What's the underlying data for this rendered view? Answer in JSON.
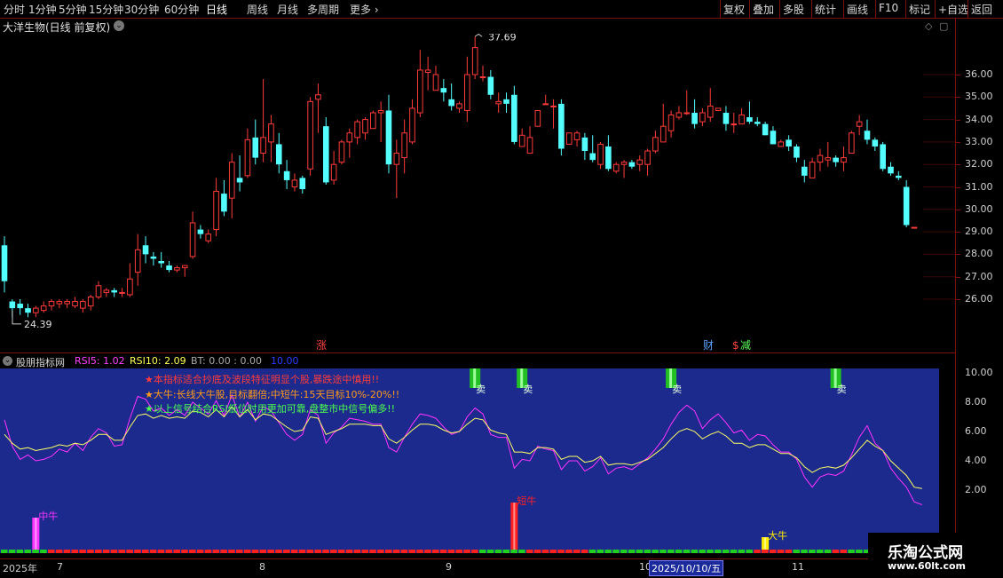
{
  "toolbar": {
    "periods": [
      "分时",
      "1分钟",
      "5分钟",
      "15分钟",
      "30分钟",
      "60分钟",
      "日线",
      "周线",
      "月线",
      "多周期"
    ],
    "active": "日线",
    "more": "更多",
    "right": [
      "复权",
      "叠加",
      "多股",
      "统计",
      "画线",
      "F10",
      "标记",
      "+自选",
      "返回"
    ]
  },
  "stock": {
    "title": "大洋生物(日线 前复权)"
  },
  "main": {
    "high_label": "37.69",
    "low_label": "24.39",
    "yticks": [
      "36.00",
      "35.00",
      "34.00",
      "33.00",
      "32.00",
      "31.00",
      "30.00",
      "29.00",
      "28.00",
      "27.00",
      "26.00"
    ],
    "markers": [
      "涨",
      "财",
      "$",
      "减"
    ]
  },
  "indicator": {
    "name": "股朋指标网",
    "rsi5": "RSI5: 1.02",
    "rsi10": "RSI10: 2.09",
    "bt": "BT: 0.00 : 0.00",
    "extra": "10.00",
    "yticks": [
      "10.00",
      "8.00",
      "6.00",
      "4.00",
      "2.00"
    ],
    "notes": [
      "★本指标适合抄底及波段特征明显个股,暴跌途中慎用!!",
      "★大牛:长线大牛股,目标翻倍;中短牛:15天目标10%-20%!!",
      "★以上信号结合RSI低位时用更加可靠,盘整市中信号偏多!!"
    ],
    "sell_label": "卖",
    "signal_labels": [
      "中牛",
      "短牛",
      "大牛"
    ]
  },
  "dates": {
    "year": "2025年",
    "months": [
      "7",
      "8",
      "9",
      "10",
      "11"
    ],
    "cursor": "2025/10/10/五"
  },
  "watermark": {
    "line1": "乐淘公式网",
    "line2": "www.60lt.com"
  },
  "chart_data": {
    "type": "candlestick",
    "price_range": [
      25.2,
      37.9
    ],
    "up_color": "#ff3b3b",
    "down_color": "#54ffff",
    "bars": [
      [
        28.4,
        26.8,
        28.8,
        26.3
      ],
      [
        25.9,
        25.6,
        26.0,
        25.2
      ],
      [
        25.8,
        25.6,
        26.0,
        25.3
      ],
      [
        25.6,
        25.4,
        25.8,
        25.2
      ],
      [
        25.4,
        25.6,
        25.7,
        25.2
      ],
      [
        25.5,
        25.7,
        25.9,
        25.4
      ],
      [
        25.7,
        25.9,
        26.0,
        25.5
      ],
      [
        25.8,
        25.9,
        26.0,
        25.6
      ],
      [
        25.8,
        25.9,
        26.0,
        25.6
      ],
      [
        25.7,
        25.9,
        26.1,
        25.6
      ],
      [
        25.6,
        25.9,
        26.0,
        25.4
      ],
      [
        25.7,
        26.1,
        26.2,
        25.5
      ],
      [
        26.1,
        26.6,
        26.8,
        26.0
      ],
      [
        26.3,
        26.4,
        26.5,
        26.1
      ],
      [
        26.4,
        26.3,
        26.5,
        26.1
      ],
      [
        26.3,
        26.3,
        26.5,
        26.1
      ],
      [
        26.2,
        26.9,
        27.6,
        26.1
      ],
      [
        27.2,
        28.2,
        28.9,
        26.6
      ],
      [
        28.4,
        28.0,
        28.8,
        27.6
      ],
      [
        27.9,
        27.8,
        28.1,
        27.5
      ],
      [
        27.7,
        27.6,
        28.1,
        27.4
      ],
      [
        27.5,
        27.3,
        27.7,
        27.2
      ],
      [
        27.3,
        27.4,
        27.5,
        27.2
      ],
      [
        27.4,
        27.5,
        27.5,
        27.0
      ],
      [
        27.9,
        29.4,
        29.9,
        27.8
      ],
      [
        29.1,
        28.9,
        29.3,
        28.7
      ],
      [
        28.6,
        28.9,
        29.1,
        28.5
      ],
      [
        29.1,
        30.8,
        31.4,
        28.8
      ],
      [
        30.7,
        29.9,
        31.3,
        29.7
      ],
      [
        30.5,
        32.1,
        32.5,
        29.6
      ],
      [
        31.4,
        31.2,
        32.4,
        30.8
      ],
      [
        31.5,
        33.1,
        33.6,
        31.4
      ],
      [
        33.2,
        32.3,
        34.0,
        32.0
      ],
      [
        32.5,
        33.2,
        35.8,
        32.1
      ],
      [
        33.0,
        33.8,
        34.2,
        32.1
      ],
      [
        32.9,
        32.0,
        33.4,
        31.6
      ],
      [
        31.7,
        31.3,
        32.2,
        30.9
      ],
      [
        31.0,
        31.3,
        31.6,
        30.8
      ],
      [
        31.4,
        30.9,
        31.5,
        30.7
      ],
      [
        31.8,
        34.8,
        35.0,
        31.5
      ],
      [
        34.9,
        35.1,
        35.6,
        33.4
      ],
      [
        33.7,
        31.2,
        34.1,
        31.1
      ],
      [
        31.3,
        32.0,
        32.6,
        31.1
      ],
      [
        32.1,
        33.0,
        33.1,
        32.0
      ],
      [
        33.0,
        33.4,
        33.6,
        32.3
      ],
      [
        33.2,
        33.9,
        34.0,
        32.9
      ],
      [
        33.4,
        34.0,
        34.1,
        33.1
      ],
      [
        33.6,
        34.3,
        34.4,
        33.6
      ],
      [
        34.3,
        34.4,
        34.8,
        33.0
      ],
      [
        34.4,
        32.0,
        35.1,
        31.6
      ],
      [
        32.0,
        32.5,
        33.1,
        30.5
      ],
      [
        32.3,
        33.4,
        34.0,
        31.6
      ],
      [
        33.0,
        34.5,
        34.9,
        32.9
      ],
      [
        34.3,
        36.2,
        37.1,
        34.1
      ],
      [
        36.1,
        36.2,
        36.8,
        35.3
      ],
      [
        35.3,
        36.0,
        36.4,
        35.7
      ],
      [
        35.4,
        35.2,
        35.8,
        34.8
      ],
      [
        34.9,
        34.6,
        35.6,
        34.4
      ],
      [
        34.5,
        34.7,
        34.8,
        34.3
      ],
      [
        34.4,
        36.0,
        36.8,
        33.9
      ],
      [
        36.0,
        37.2,
        37.7,
        35.8
      ],
      [
        35.9,
        35.9,
        36.4,
        35.7
      ],
      [
        35.9,
        35.1,
        36.2,
        34.9
      ],
      [
        34.7,
        34.8,
        35.2,
        34.3
      ],
      [
        34.9,
        34.7,
        35.2,
        34.3
      ],
      [
        35.1,
        33.0,
        35.5,
        32.9
      ],
      [
        32.8,
        33.3,
        33.6,
        32.8
      ],
      [
        32.5,
        33.2,
        33.7,
        32.6
      ],
      [
        33.7,
        34.4,
        34.4,
        33.7
      ],
      [
        34.7,
        34.7,
        35.1,
        34.7
      ],
      [
        34.6,
        34.6,
        34.9,
        33.6
      ],
      [
        34.7,
        32.7,
        34.9,
        32.4
      ],
      [
        32.9,
        33.4,
        33.4,
        33.1
      ],
      [
        33.1,
        33.4,
        33.5,
        32.8
      ],
      [
        33.2,
        32.6,
        33.4,
        32.2
      ],
      [
        32.5,
        32.2,
        33.3,
        32.1
      ],
      [
        32.0,
        32.9,
        33.0,
        31.8
      ],
      [
        32.8,
        31.8,
        33.3,
        31.7
      ],
      [
        31.7,
        32.0,
        32.1,
        31.6
      ],
      [
        32.0,
        32.1,
        32.2,
        31.4
      ],
      [
        32.1,
        31.9,
        32.2,
        31.8
      ],
      [
        32.0,
        32.2,
        32.4,
        31.7
      ],
      [
        32.0,
        32.6,
        32.7,
        31.5
      ],
      [
        32.6,
        33.2,
        33.5,
        32.5
      ],
      [
        33.0,
        33.7,
        34.7,
        33.0
      ],
      [
        33.5,
        34.2,
        34.4,
        33.2
      ],
      [
        34.1,
        34.3,
        34.6,
        34.0
      ],
      [
        34.3,
        34.3,
        35.3,
        34.2
      ],
      [
        34.3,
        33.8,
        34.9,
        33.6
      ],
      [
        33.9,
        34.3,
        34.5,
        33.7
      ],
      [
        34.1,
        34.6,
        35.4,
        33.9
      ],
      [
        34.4,
        34.5,
        34.5,
        34.4
      ],
      [
        34.3,
        33.8,
        34.6,
        33.5
      ],
      [
        33.8,
        33.8,
        34.3,
        33.4
      ],
      [
        33.8,
        34.2,
        34.5,
        33.8
      ],
      [
        34.1,
        33.9,
        34.8,
        33.8
      ],
      [
        33.9,
        33.8,
        34.1,
        33.7
      ],
      [
        33.8,
        33.3,
        33.9,
        33.3
      ],
      [
        33.5,
        32.9,
        33.7,
        32.9
      ],
      [
        32.8,
        33.0,
        33.1,
        32.8
      ],
      [
        33.1,
        32.8,
        33.3,
        32.6
      ],
      [
        32.8,
        32.3,
        32.9,
        32.1
      ],
      [
        31.9,
        31.5,
        32.2,
        31.2
      ],
      [
        31.4,
        32.1,
        32.3,
        31.4
      ],
      [
        32.1,
        32.4,
        32.7,
        31.7
      ],
      [
        32.2,
        32.3,
        33.0,
        31.9
      ],
      [
        32.3,
        32.1,
        32.4,
        31.9
      ],
      [
        32.1,
        32.3,
        32.8,
        31.7
      ],
      [
        32.5,
        33.4,
        33.5,
        32.6
      ],
      [
        33.7,
        33.9,
        34.2,
        33.3
      ],
      [
        33.5,
        33.1,
        34.0,
        32.9
      ],
      [
        33.1,
        32.8,
        33.2,
        32.6
      ],
      [
        32.9,
        31.8,
        33.0,
        31.7
      ],
      [
        31.9,
        31.6,
        32.1,
        31.5
      ],
      [
        31.5,
        31.4,
        31.7,
        31.3
      ],
      [
        31.0,
        29.3,
        31.3,
        29.2
      ],
      [
        29.2,
        29.2,
        29.2,
        29.2
      ]
    ],
    "rsi5": [
      6.8,
      5.0,
      4.1,
      4.4,
      4.0,
      4.1,
      4.3,
      4.8,
      4.6,
      5.2,
      4.7,
      5.6,
      6.2,
      5.9,
      5.0,
      5.1,
      6.9,
      8.4,
      8.2,
      7.4,
      7.6,
      7.1,
      7.5,
      7.1,
      8.0,
      7.6,
      7.2,
      8.1,
      7.1,
      8.5,
      7.0,
      8.0,
      6.7,
      7.7,
      7.4,
      6.6,
      5.8,
      5.4,
      5.8,
      7.5,
      7.1,
      5.2,
      5.9,
      6.3,
      6.9,
      6.8,
      6.7,
      6.5,
      6.5,
      4.9,
      4.6,
      5.6,
      6.5,
      7.2,
      7.1,
      6.9,
      6.3,
      5.8,
      6.0,
      7.0,
      7.6,
      7.2,
      5.8,
      5.6,
      5.6,
      3.5,
      4.1,
      4.0,
      5.0,
      4.8,
      4.7,
      3.4,
      4.0,
      4.0,
      3.3,
      3.6,
      4.2,
      3.1,
      3.5,
      3.6,
      3.4,
      3.8,
      4.2,
      4.8,
      5.5,
      6.5,
      7.3,
      7.8,
      7.4,
      6.2,
      6.8,
      7.2,
      6.6,
      5.9,
      6.1,
      5.4,
      5.8,
      5.7,
      5.1,
      4.6,
      4.6,
      4.1,
      2.9,
      2.2,
      2.9,
      3.1,
      3.0,
      3.3,
      4.4,
      5.6,
      6.4,
      5.2,
      4.7,
      3.5,
      2.8,
      2.2,
      1.2,
      1.0
    ],
    "rsi10": [
      5.8,
      5.2,
      4.8,
      4.9,
      4.7,
      4.8,
      4.9,
      5.1,
      5.0,
      5.2,
      5.1,
      5.4,
      5.8,
      5.8,
      5.4,
      5.4,
      6.3,
      7.1,
      7.2,
      6.9,
      7.1,
      6.9,
      7.0,
      6.9,
      7.4,
      7.3,
      7.0,
      7.5,
      7.0,
      7.7,
      7.0,
      7.5,
      6.8,
      7.2,
      7.1,
      6.7,
      6.3,
      6.0,
      6.1,
      7.0,
      6.9,
      5.8,
      6.0,
      6.2,
      6.5,
      6.5,
      6.5,
      6.4,
      6.4,
      5.5,
      5.2,
      5.6,
      6.1,
      6.5,
      6.5,
      6.4,
      6.1,
      5.9,
      6.0,
      6.5,
      6.9,
      6.8,
      6.1,
      5.9,
      5.8,
      4.6,
      4.6,
      4.5,
      4.9,
      4.9,
      4.8,
      4.1,
      4.3,
      4.3,
      3.9,
      4.0,
      4.3,
      3.7,
      3.8,
      3.8,
      3.7,
      3.9,
      4.1,
      4.5,
      4.9,
      5.5,
      6.0,
      6.2,
      6.0,
      5.5,
      5.8,
      6.0,
      5.7,
      5.2,
      5.2,
      4.9,
      5.1,
      5.1,
      4.8,
      4.5,
      4.5,
      4.2,
      3.6,
      3.2,
      3.5,
      3.6,
      3.5,
      3.7,
      4.2,
      4.8,
      5.4,
      5.0,
      4.7,
      4.0,
      3.5,
      3.0,
      2.2,
      2.1
    ],
    "sell_signals": [
      60,
      66,
      85,
      106
    ],
    "signals": [
      {
        "type": "中牛",
        "index": 4
      },
      {
        "type": "短牛",
        "index": 65
      },
      {
        "type": "大牛",
        "index": 97
      }
    ],
    "bottom_strip": "alternating green and red bars"
  }
}
